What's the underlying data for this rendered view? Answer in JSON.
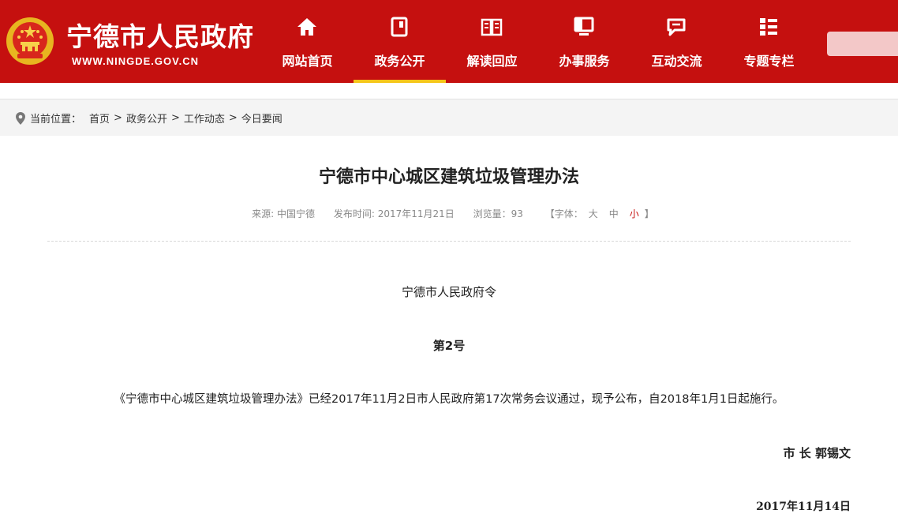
{
  "header": {
    "site_title": "宁德市人民政府",
    "site_url": "WWW.NINGDE.GOV.CN",
    "brand_color": "#c5100f",
    "nav": [
      {
        "label": "网站首页",
        "icon": "home-icon"
      },
      {
        "label": "政务公开",
        "icon": "document-icon",
        "active": true
      },
      {
        "label": "解读回应",
        "icon": "open-book-icon"
      },
      {
        "label": "办事服务",
        "icon": "monitor-icon"
      },
      {
        "label": "互动交流",
        "icon": "chat-icon"
      },
      {
        "label": "专题专栏",
        "icon": "list-icon"
      }
    ]
  },
  "breadcrumb": {
    "prefix": "当前位置：",
    "items": [
      "首页",
      "政务公开",
      "工作动态",
      "今日要闻"
    ],
    "separator": ">"
  },
  "article": {
    "title": "宁德市中心城区建筑垃圾管理办法",
    "meta": {
      "source": "来源: 中国宁德",
      "published": "发布时间: 2017年11月21日",
      "views": "浏览量：93",
      "font_prefix": "【字体：",
      "font_sizes": [
        "大",
        "中",
        "小"
      ],
      "font_suffix": "】"
    },
    "decree_title": "宁德市人民政府令",
    "decree_number": "第2号",
    "body": "《宁德市中心城区建筑垃圾管理办法》已经2017年11月2日市人民政府第17次常务会议通过，现予公布，自2018年1月1日起施行。",
    "signature": "市 长  郭锡文",
    "date": "2017年11月14日"
  }
}
